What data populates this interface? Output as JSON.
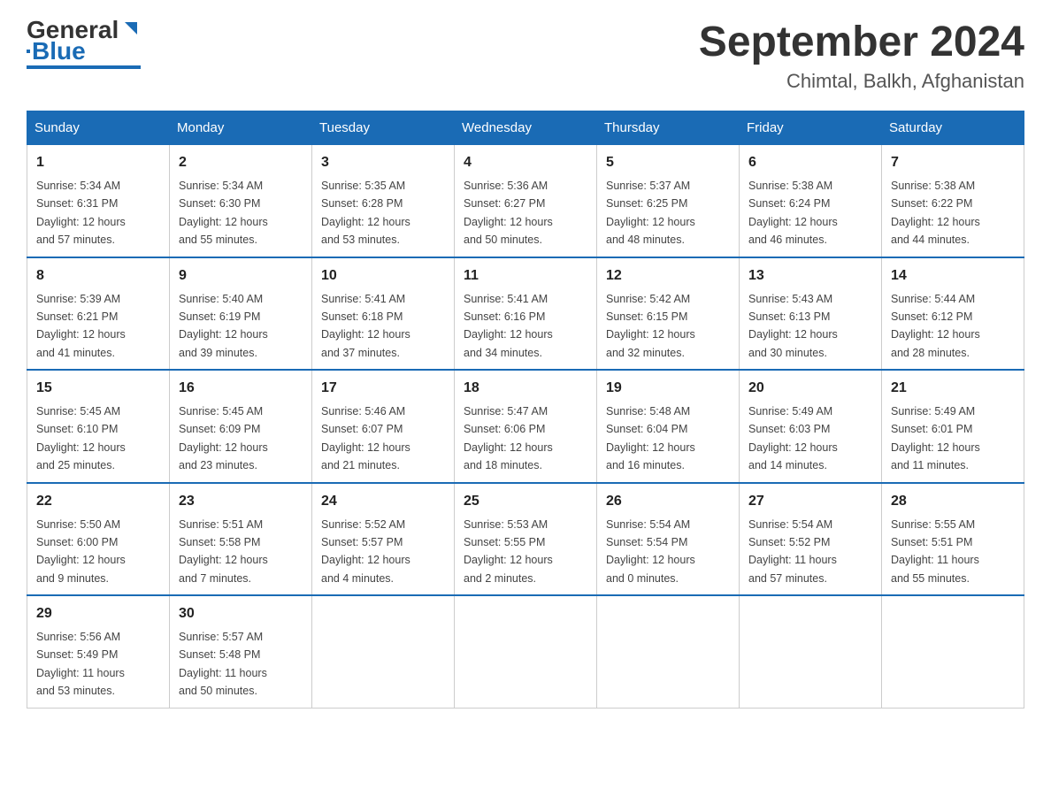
{
  "header": {
    "logo_general": "General",
    "logo_blue": "Blue",
    "month_title": "September 2024",
    "subtitle": "Chimtal, Balkh, Afghanistan"
  },
  "weekdays": [
    "Sunday",
    "Monday",
    "Tuesday",
    "Wednesday",
    "Thursday",
    "Friday",
    "Saturday"
  ],
  "weeks": [
    [
      {
        "day": "1",
        "sunrise": "5:34 AM",
        "sunset": "6:31 PM",
        "daylight": "12 hours and 57 minutes."
      },
      {
        "day": "2",
        "sunrise": "5:34 AM",
        "sunset": "6:30 PM",
        "daylight": "12 hours and 55 minutes."
      },
      {
        "day": "3",
        "sunrise": "5:35 AM",
        "sunset": "6:28 PM",
        "daylight": "12 hours and 53 minutes."
      },
      {
        "day": "4",
        "sunrise": "5:36 AM",
        "sunset": "6:27 PM",
        "daylight": "12 hours and 50 minutes."
      },
      {
        "day": "5",
        "sunrise": "5:37 AM",
        "sunset": "6:25 PM",
        "daylight": "12 hours and 48 minutes."
      },
      {
        "day": "6",
        "sunrise": "5:38 AM",
        "sunset": "6:24 PM",
        "daylight": "12 hours and 46 minutes."
      },
      {
        "day": "7",
        "sunrise": "5:38 AM",
        "sunset": "6:22 PM",
        "daylight": "12 hours and 44 minutes."
      }
    ],
    [
      {
        "day": "8",
        "sunrise": "5:39 AM",
        "sunset": "6:21 PM",
        "daylight": "12 hours and 41 minutes."
      },
      {
        "day": "9",
        "sunrise": "5:40 AM",
        "sunset": "6:19 PM",
        "daylight": "12 hours and 39 minutes."
      },
      {
        "day": "10",
        "sunrise": "5:41 AM",
        "sunset": "6:18 PM",
        "daylight": "12 hours and 37 minutes."
      },
      {
        "day": "11",
        "sunrise": "5:41 AM",
        "sunset": "6:16 PM",
        "daylight": "12 hours and 34 minutes."
      },
      {
        "day": "12",
        "sunrise": "5:42 AM",
        "sunset": "6:15 PM",
        "daylight": "12 hours and 32 minutes."
      },
      {
        "day": "13",
        "sunrise": "5:43 AM",
        "sunset": "6:13 PM",
        "daylight": "12 hours and 30 minutes."
      },
      {
        "day": "14",
        "sunrise": "5:44 AM",
        "sunset": "6:12 PM",
        "daylight": "12 hours and 28 minutes."
      }
    ],
    [
      {
        "day": "15",
        "sunrise": "5:45 AM",
        "sunset": "6:10 PM",
        "daylight": "12 hours and 25 minutes."
      },
      {
        "day": "16",
        "sunrise": "5:45 AM",
        "sunset": "6:09 PM",
        "daylight": "12 hours and 23 minutes."
      },
      {
        "day": "17",
        "sunrise": "5:46 AM",
        "sunset": "6:07 PM",
        "daylight": "12 hours and 21 minutes."
      },
      {
        "day": "18",
        "sunrise": "5:47 AM",
        "sunset": "6:06 PM",
        "daylight": "12 hours and 18 minutes."
      },
      {
        "day": "19",
        "sunrise": "5:48 AM",
        "sunset": "6:04 PM",
        "daylight": "12 hours and 16 minutes."
      },
      {
        "day": "20",
        "sunrise": "5:49 AM",
        "sunset": "6:03 PM",
        "daylight": "12 hours and 14 minutes."
      },
      {
        "day": "21",
        "sunrise": "5:49 AM",
        "sunset": "6:01 PM",
        "daylight": "12 hours and 11 minutes."
      }
    ],
    [
      {
        "day": "22",
        "sunrise": "5:50 AM",
        "sunset": "6:00 PM",
        "daylight": "12 hours and 9 minutes."
      },
      {
        "day": "23",
        "sunrise": "5:51 AM",
        "sunset": "5:58 PM",
        "daylight": "12 hours and 7 minutes."
      },
      {
        "day": "24",
        "sunrise": "5:52 AM",
        "sunset": "5:57 PM",
        "daylight": "12 hours and 4 minutes."
      },
      {
        "day": "25",
        "sunrise": "5:53 AM",
        "sunset": "5:55 PM",
        "daylight": "12 hours and 2 minutes."
      },
      {
        "day": "26",
        "sunrise": "5:54 AM",
        "sunset": "5:54 PM",
        "daylight": "12 hours and 0 minutes."
      },
      {
        "day": "27",
        "sunrise": "5:54 AM",
        "sunset": "5:52 PM",
        "daylight": "11 hours and 57 minutes."
      },
      {
        "day": "28",
        "sunrise": "5:55 AM",
        "sunset": "5:51 PM",
        "daylight": "11 hours and 55 minutes."
      }
    ],
    [
      {
        "day": "29",
        "sunrise": "5:56 AM",
        "sunset": "5:49 PM",
        "daylight": "11 hours and 53 minutes."
      },
      {
        "day": "30",
        "sunrise": "5:57 AM",
        "sunset": "5:48 PM",
        "daylight": "11 hours and 50 minutes."
      },
      null,
      null,
      null,
      null,
      null
    ]
  ],
  "labels": {
    "sunrise": "Sunrise:",
    "sunset": "Sunset:",
    "daylight": "Daylight:"
  }
}
